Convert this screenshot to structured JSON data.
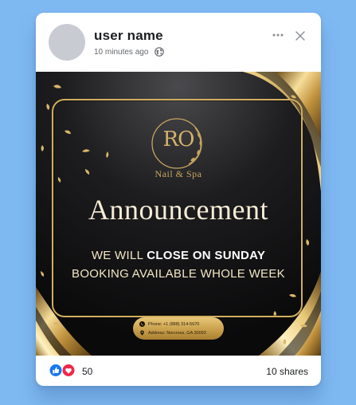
{
  "post_header": {
    "user_name": "user name",
    "time_ago": "10 minutes ago",
    "privacy_icon": "globe-icon",
    "more_icon": "more-horizontal-icon",
    "close_icon": "close-icon"
  },
  "post_image": {
    "logo_monogram": "RO",
    "logo_tagline": "Nail & Spa",
    "headline": "Announcement",
    "line1_prefix": "WE WILL ",
    "line1_emphasis": "CLOSE ON SUNDAY",
    "line2": "BOOKING AVAILABLE WHOLE WEEK",
    "phone": "Phone: +1 (888) 314-5670",
    "address": "Address: Norcross, GA 30093",
    "colors": {
      "gold": "#d2ae5e",
      "background": "#0f0f10",
      "text_light": "#f6ecd6"
    }
  },
  "post_footer": {
    "reaction_icons": [
      "like-icon",
      "love-icon"
    ],
    "reaction_count": "50",
    "shares": "10 shares"
  }
}
